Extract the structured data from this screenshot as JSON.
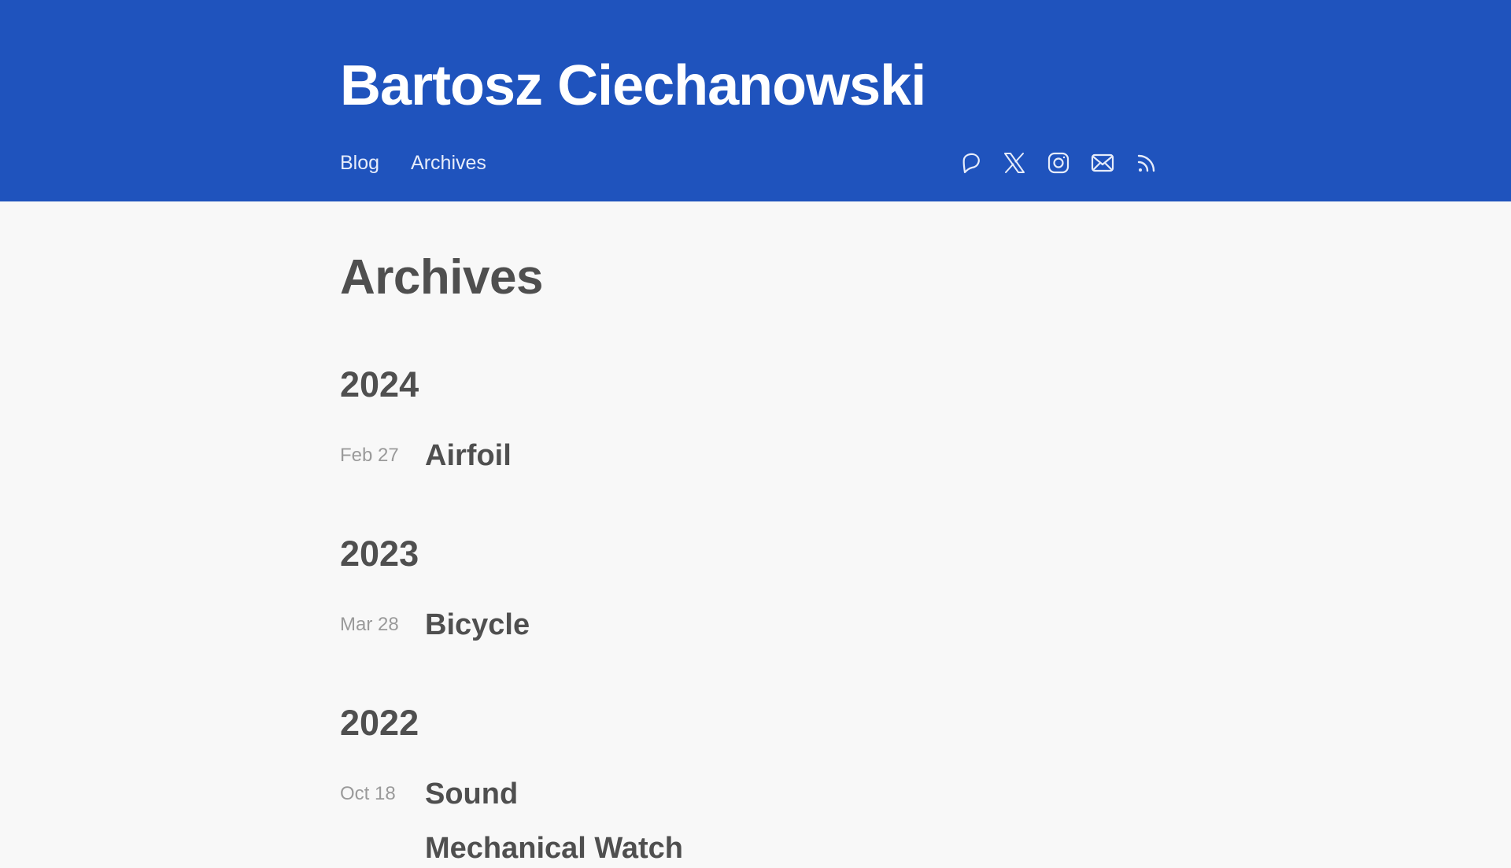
{
  "header": {
    "site_title": "Bartosz Ciechanowski",
    "nav": [
      {
        "label": "Blog"
      },
      {
        "label": "Archives"
      }
    ],
    "social_icons": [
      "patreon-icon",
      "x-icon",
      "instagram-icon",
      "mail-icon",
      "rss-icon"
    ],
    "background_color": "#1f53bd"
  },
  "main": {
    "page_title": "Archives",
    "years": [
      {
        "year": "2024",
        "posts": [
          {
            "date": "Feb 27",
            "title": "Airfoil"
          }
        ]
      },
      {
        "year": "2023",
        "posts": [
          {
            "date": "Mar 28",
            "title": "Bicycle"
          }
        ]
      },
      {
        "year": "2022",
        "posts": [
          {
            "date": "Oct 18",
            "title": "Sound"
          },
          {
            "date": "",
            "title": "Mechanical Watch"
          }
        ]
      }
    ]
  },
  "colors": {
    "text": "#4f4f4f",
    "muted": "#9a9a9a",
    "background": "#f8f8f8"
  }
}
